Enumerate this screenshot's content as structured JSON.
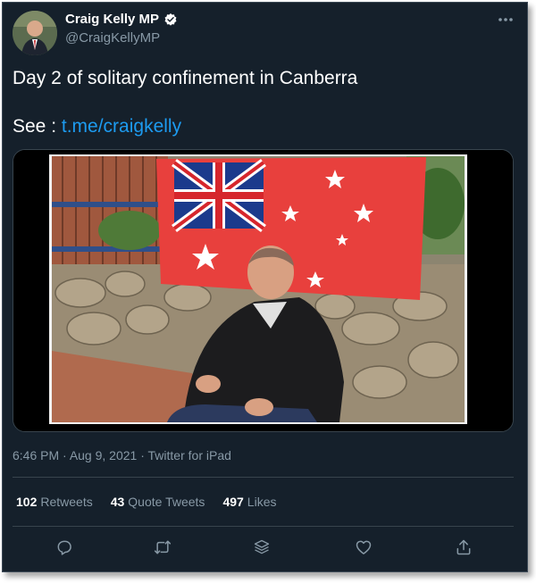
{
  "author": {
    "display_name": "Craig Kelly MP",
    "handle": "@CraigKellyMP",
    "verified": true
  },
  "tweet": {
    "line1": "Day 2 of solitary confinement in Canberra",
    "see_label": "See : ",
    "link_text": "t.me/craigkelly"
  },
  "media": {
    "alt": "Video frame of a man in a black leather jacket seated in front of a red ensign flag on a stone wall"
  },
  "meta": {
    "time": "6:46 PM",
    "date": "Aug 9, 2021",
    "source": "Twitter for iPad",
    "separator": " · "
  },
  "stats": {
    "retweets_count": "102",
    "retweets_label": "Retweets",
    "quotes_count": "43",
    "quotes_label": "Quote Tweets",
    "likes_count": "497",
    "likes_label": "Likes"
  },
  "actions": [
    "reply-icon",
    "retweet-icon",
    "share-stack-icon",
    "like-icon",
    "share-icon"
  ],
  "colors": {
    "background": "#15202b",
    "link": "#1d9bf0",
    "secondary_text": "#8899a6",
    "divider": "#38444d"
  }
}
